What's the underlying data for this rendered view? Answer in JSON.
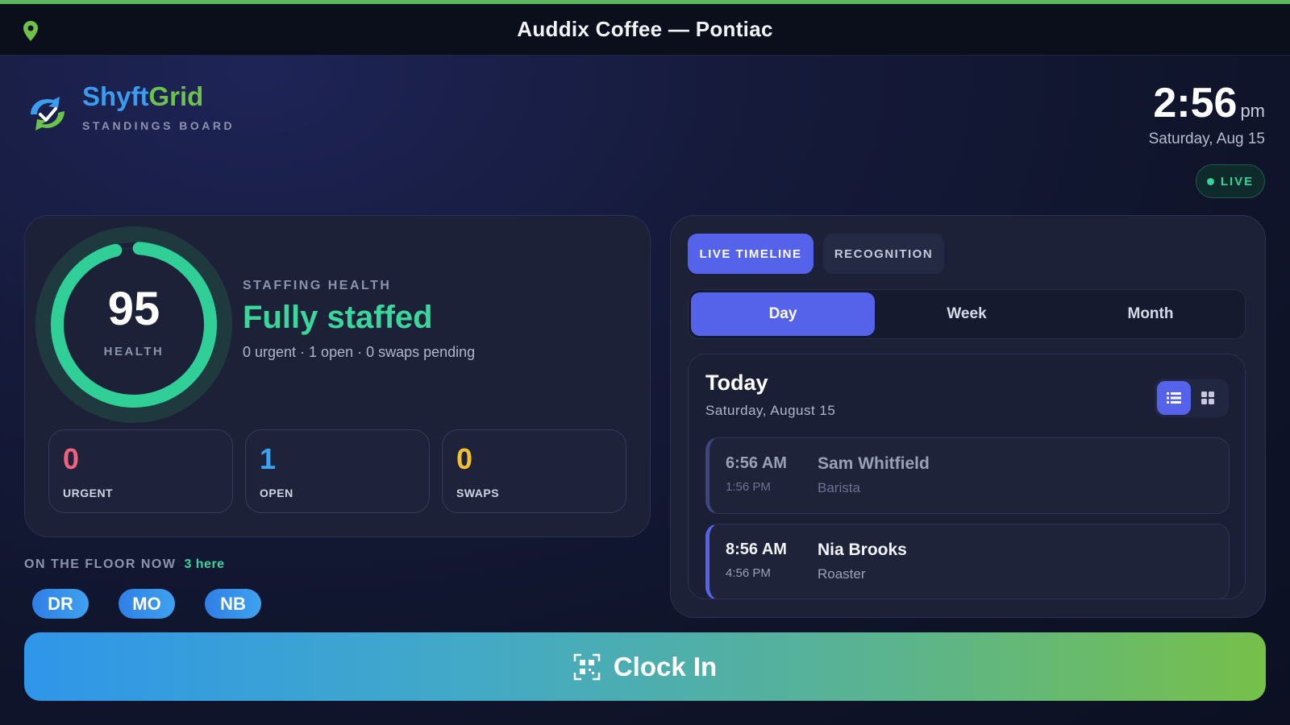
{
  "titlebar": {
    "title": "Auddix Coffee — Pontiac"
  },
  "brand": {
    "name_part1": "Shyft",
    "name_part2": "Grid",
    "subtitle": "STANDINGS BOARD"
  },
  "clock": {
    "time": "2:56",
    "ampm": "pm",
    "date": "Saturday, Aug 15",
    "live_label": "LIVE"
  },
  "health": {
    "score": "95",
    "score_fraction": 0.95,
    "score_label": "HEALTH",
    "section_label": "STAFFING HEALTH",
    "status": "Fully staffed",
    "detail": "0 urgent · 1 open · 0 swaps pending",
    "stats": [
      {
        "value": "0",
        "label": "URGENT",
        "color": "#f0627d"
      },
      {
        "value": "1",
        "label": "OPEN",
        "color": "#3ba4f0"
      },
      {
        "value": "0",
        "label": "SWAPS",
        "color": "#f2c12e"
      }
    ]
  },
  "floor": {
    "label": "ON THE FLOOR NOW",
    "count": "3 here",
    "people": [
      "DR",
      "MO",
      "NB"
    ]
  },
  "timeline": {
    "tabs": [
      "LIVE TIMELINE",
      "RECOGNITION"
    ],
    "range": [
      "Day",
      "Week",
      "Month"
    ],
    "selected_range": "Day",
    "heading": "Today",
    "date": "Saturday, August 15",
    "shifts": [
      {
        "start": "6:56 AM",
        "end": "1:56 PM",
        "name": "Sam Whitfield",
        "role": "Barista"
      },
      {
        "start": "8:56 AM",
        "end": "4:56 PM",
        "name": "Nia Brooks",
        "role": "Roaster"
      }
    ]
  },
  "action": {
    "clock_in_label": "Clock In"
  },
  "colors": {
    "accent": "#5563ea",
    "success": "#3bd69b",
    "brand_blue": "#3b9cf0",
    "brand_green": "#6cc24a"
  }
}
